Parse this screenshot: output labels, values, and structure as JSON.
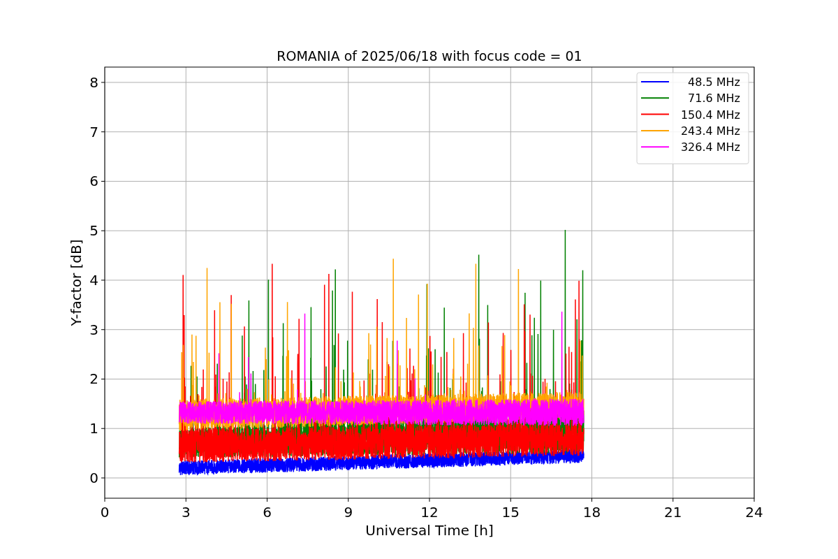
{
  "figure": {
    "title": "ROMANIA of 2025/06/18 with focus code = 01",
    "x_axis": {
      "label": "Universal Time [h]",
      "ticks": [
        "0",
        "3",
        "6",
        "9",
        "12",
        "15",
        "18",
        "21",
        "24"
      ]
    },
    "y_axis": {
      "label": "Y-factor [dB]",
      "ticks": [
        "8",
        "7",
        "6",
        "5",
        "4",
        "3",
        "2",
        "1",
        "0"
      ]
    },
    "legend": [
      {
        "label": "48.5 MHz",
        "color": "#0000ff"
      },
      {
        "label": "71.6 MHz",
        "color": "#008000"
      },
      {
        "label": "150.4 MHz",
        "color": "#ff0000"
      },
      {
        "label": "243.4 MHz",
        "color": "#ffa500"
      },
      {
        "label": "326.4 MHz",
        "color": "#ff00ff"
      }
    ]
  }
}
